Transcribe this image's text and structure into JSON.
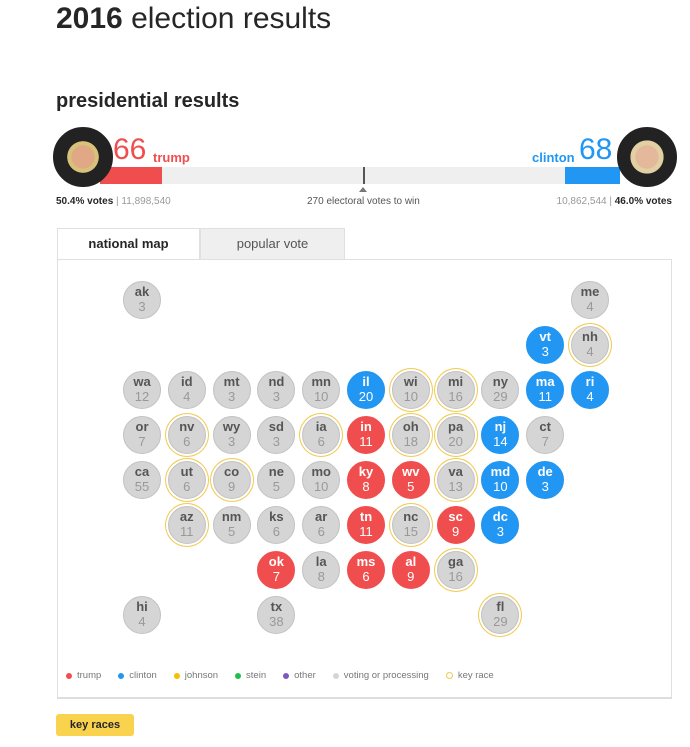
{
  "title_bold": "2016",
  "title_rest": " election results",
  "subtitle": "presidential results",
  "trump": {
    "name": "trump",
    "electoral": "66",
    "pct": "50.4% votes",
    "popular": "11,898,540",
    "color": "#f04e4e"
  },
  "clinton": {
    "name": "clinton",
    "electoral": "68",
    "pct": "46.0% votes",
    "popular": "10,862,544",
    "color": "#2196f3"
  },
  "to_win": "270 electoral votes to win",
  "tabs": [
    {
      "label": "national map",
      "active": true
    },
    {
      "label": "popular vote",
      "active": false
    }
  ],
  "states": [
    {
      "ab": "ak",
      "ev": "3",
      "row": 0,
      "col": 0,
      "w": "none",
      "key": false
    },
    {
      "ab": "me",
      "ev": "4",
      "row": 0,
      "col": 10,
      "w": "none",
      "key": false
    },
    {
      "ab": "vt",
      "ev": "3",
      "row": 1,
      "col": 9,
      "w": "clinton",
      "key": false
    },
    {
      "ab": "nh",
      "ev": "4",
      "row": 1,
      "col": 10,
      "w": "none",
      "key": true
    },
    {
      "ab": "wa",
      "ev": "12",
      "row": 2,
      "col": 0,
      "w": "none",
      "key": false
    },
    {
      "ab": "id",
      "ev": "4",
      "row": 2,
      "col": 1,
      "w": "none",
      "key": false
    },
    {
      "ab": "mt",
      "ev": "3",
      "row": 2,
      "col": 2,
      "w": "none",
      "key": false
    },
    {
      "ab": "nd",
      "ev": "3",
      "row": 2,
      "col": 3,
      "w": "none",
      "key": false
    },
    {
      "ab": "mn",
      "ev": "10",
      "row": 2,
      "col": 4,
      "w": "none",
      "key": false
    },
    {
      "ab": "il",
      "ev": "20",
      "row": 2,
      "col": 5,
      "w": "clinton",
      "key": false
    },
    {
      "ab": "wi",
      "ev": "10",
      "row": 2,
      "col": 6,
      "w": "none",
      "key": true
    },
    {
      "ab": "mi",
      "ev": "16",
      "row": 2,
      "col": 7,
      "w": "none",
      "key": true
    },
    {
      "ab": "ny",
      "ev": "29",
      "row": 2,
      "col": 8,
      "w": "none",
      "key": false
    },
    {
      "ab": "ma",
      "ev": "11",
      "row": 2,
      "col": 9,
      "w": "clinton",
      "key": false
    },
    {
      "ab": "ri",
      "ev": "4",
      "row": 2,
      "col": 10,
      "w": "clinton",
      "key": false
    },
    {
      "ab": "or",
      "ev": "7",
      "row": 3,
      "col": 0,
      "w": "none",
      "key": false
    },
    {
      "ab": "nv",
      "ev": "6",
      "row": 3,
      "col": 1,
      "w": "none",
      "key": true
    },
    {
      "ab": "wy",
      "ev": "3",
      "row": 3,
      "col": 2,
      "w": "none",
      "key": false
    },
    {
      "ab": "sd",
      "ev": "3",
      "row": 3,
      "col": 3,
      "w": "none",
      "key": false
    },
    {
      "ab": "ia",
      "ev": "6",
      "row": 3,
      "col": 4,
      "w": "none",
      "key": true
    },
    {
      "ab": "in",
      "ev": "11",
      "row": 3,
      "col": 5,
      "w": "trump",
      "key": false
    },
    {
      "ab": "oh",
      "ev": "18",
      "row": 3,
      "col": 6,
      "w": "none",
      "key": true
    },
    {
      "ab": "pa",
      "ev": "20",
      "row": 3,
      "col": 7,
      "w": "none",
      "key": true
    },
    {
      "ab": "nj",
      "ev": "14",
      "row": 3,
      "col": 8,
      "w": "clinton",
      "key": false
    },
    {
      "ab": "ct",
      "ev": "7",
      "row": 3,
      "col": 9,
      "w": "none",
      "key": false
    },
    {
      "ab": "ca",
      "ev": "55",
      "row": 4,
      "col": 0,
      "w": "none",
      "key": false
    },
    {
      "ab": "ut",
      "ev": "6",
      "row": 4,
      "col": 1,
      "w": "none",
      "key": true
    },
    {
      "ab": "co",
      "ev": "9",
      "row": 4,
      "col": 2,
      "w": "none",
      "key": true
    },
    {
      "ab": "ne",
      "ev": "5",
      "row": 4,
      "col": 3,
      "w": "none",
      "key": false
    },
    {
      "ab": "mo",
      "ev": "10",
      "row": 4,
      "col": 4,
      "w": "none",
      "key": false
    },
    {
      "ab": "ky",
      "ev": "8",
      "row": 4,
      "col": 5,
      "w": "trump",
      "key": false
    },
    {
      "ab": "wv",
      "ev": "5",
      "row": 4,
      "col": 6,
      "w": "trump",
      "key": false
    },
    {
      "ab": "va",
      "ev": "13",
      "row": 4,
      "col": 7,
      "w": "none",
      "key": true
    },
    {
      "ab": "md",
      "ev": "10",
      "row": 4,
      "col": 8,
      "w": "clinton",
      "key": false
    },
    {
      "ab": "de",
      "ev": "3",
      "row": 4,
      "col": 9,
      "w": "clinton",
      "key": false
    },
    {
      "ab": "az",
      "ev": "11",
      "row": 5,
      "col": 1,
      "w": "none",
      "key": true
    },
    {
      "ab": "nm",
      "ev": "5",
      "row": 5,
      "col": 2,
      "w": "none",
      "key": false
    },
    {
      "ab": "ks",
      "ev": "6",
      "row": 5,
      "col": 3,
      "w": "none",
      "key": false
    },
    {
      "ab": "ar",
      "ev": "6",
      "row": 5,
      "col": 4,
      "w": "none",
      "key": false
    },
    {
      "ab": "tn",
      "ev": "11",
      "row": 5,
      "col": 5,
      "w": "trump",
      "key": false
    },
    {
      "ab": "nc",
      "ev": "15",
      "row": 5,
      "col": 6,
      "w": "none",
      "key": true
    },
    {
      "ab": "sc",
      "ev": "9",
      "row": 5,
      "col": 7,
      "w": "trump",
      "key": false
    },
    {
      "ab": "dc",
      "ev": "3",
      "row": 5,
      "col": 8,
      "w": "clinton",
      "key": false
    },
    {
      "ab": "ok",
      "ev": "7",
      "row": 6,
      "col": 3,
      "w": "trump",
      "key": false
    },
    {
      "ab": "la",
      "ev": "8",
      "row": 6,
      "col": 4,
      "w": "none",
      "key": false
    },
    {
      "ab": "ms",
      "ev": "6",
      "row": 6,
      "col": 5,
      "w": "trump",
      "key": false
    },
    {
      "ab": "al",
      "ev": "9",
      "row": 6,
      "col": 6,
      "w": "trump",
      "key": false
    },
    {
      "ab": "ga",
      "ev": "16",
      "row": 6,
      "col": 7,
      "w": "none",
      "key": true
    },
    {
      "ab": "hi",
      "ev": "4",
      "row": 7,
      "col": 0,
      "w": "none",
      "key": false
    },
    {
      "ab": "tx",
      "ev": "38",
      "row": 7,
      "col": 3,
      "w": "none",
      "key": false
    },
    {
      "ab": "fl",
      "ev": "29",
      "row": 7,
      "col": 8,
      "w": "none",
      "key": true
    }
  ],
  "legend": [
    {
      "label": "trump",
      "color": "#f04e4e"
    },
    {
      "label": "clinton",
      "color": "#2196f3"
    },
    {
      "label": "johnson",
      "color": "#f5c000"
    },
    {
      "label": "stein",
      "color": "#1fbf4a"
    },
    {
      "label": "other",
      "color": "#7e57c2"
    },
    {
      "label": "voting or processing",
      "color": "#d5d5d5"
    },
    {
      "label": "key race",
      "color": "#f2c94c",
      "ring": true
    }
  ],
  "key_races_button": "key races"
}
